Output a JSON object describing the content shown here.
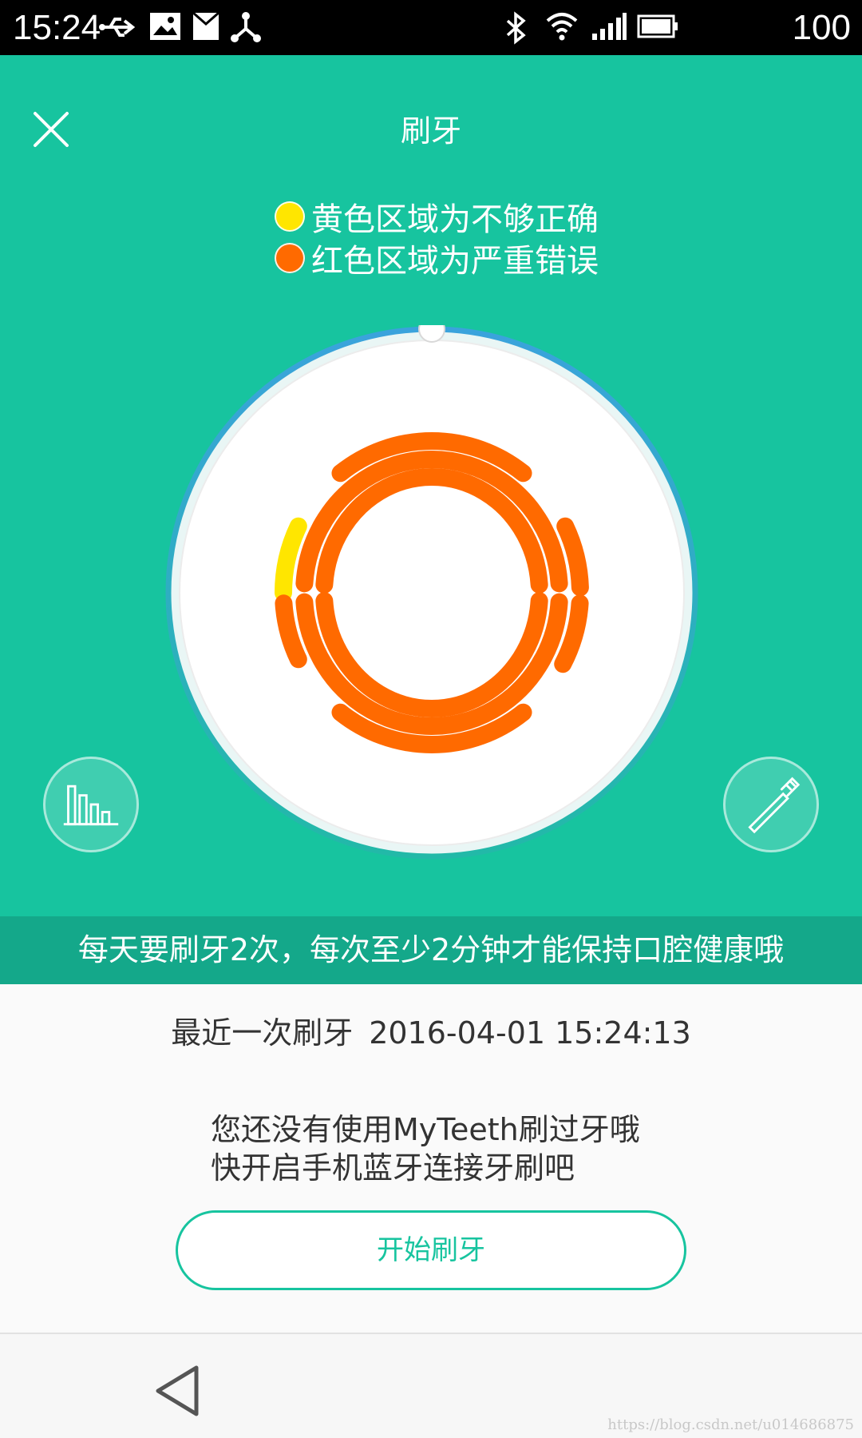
{
  "status_bar": {
    "time": "15:24",
    "battery_level": "100",
    "icons": [
      "usb-icon",
      "image-icon",
      "notification-icon",
      "share-icon",
      "bluetooth-icon",
      "wifi-icon",
      "signal-icon",
      "battery-icon"
    ]
  },
  "header": {
    "title": "刷牙",
    "close_icon": "close-icon"
  },
  "legend": {
    "items": [
      {
        "color": "#ffe600",
        "label": "黄色区域为不够正确"
      },
      {
        "color": "#ff6a00",
        "label": "红色区域为严重错误"
      }
    ]
  },
  "teeth_map": {
    "ring_color": "#3aa3dc",
    "normal_color": "#ff6a00",
    "warning_color": "#ffe600",
    "warning_segments": 1,
    "error_segments": 17
  },
  "actions": {
    "stats_icon": "bar-chart-icon",
    "brush_icon": "toothbrush-icon"
  },
  "tip": "每天要刷牙2次，每次至少2分钟才能保持口腔健康哦",
  "last_brush": {
    "label": "最近一次刷牙",
    "timestamp": "2016-04-01 15:24:13"
  },
  "notice": {
    "line1": "您还没有使用MyTeeth刷过牙哦",
    "line2": "快开启手机蓝牙连接牙刷吧"
  },
  "start_button": "开始刷牙",
  "nav": {
    "back_icon": "back-triangle-icon"
  },
  "watermark": "https://blog.csdn.net/u014686875",
  "colors": {
    "accent": "#17c49f",
    "tip_bar": "#14a88a"
  }
}
